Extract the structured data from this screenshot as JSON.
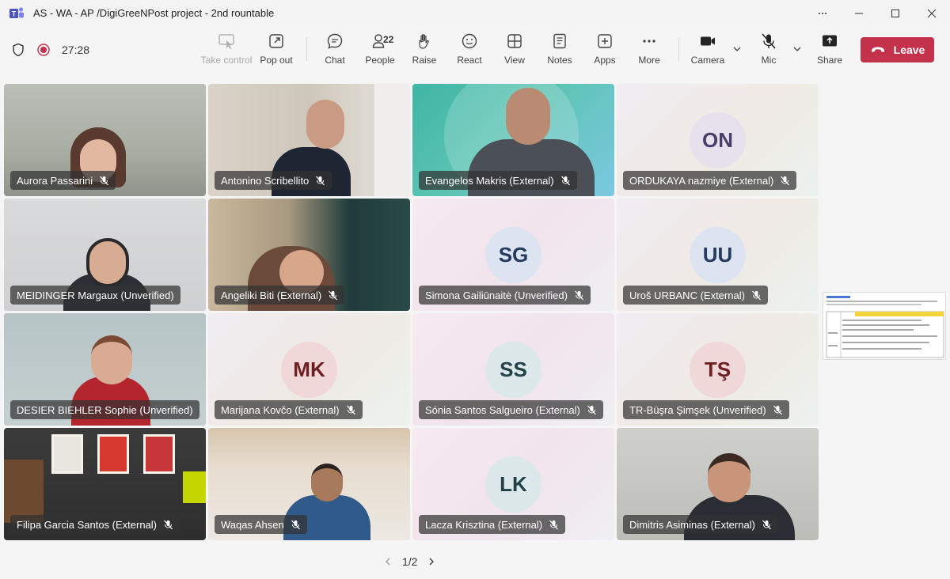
{
  "window": {
    "title": "AS - WA - AP /DigiGreeNPost project - 2nd rountable"
  },
  "toolbar": {
    "timer": "27:28",
    "take_control": "Take control",
    "pop_out": "Pop out",
    "chat": "Chat",
    "people": "People",
    "people_count": "22",
    "raise": "Raise",
    "react": "React",
    "view": "View",
    "notes": "Notes",
    "apps": "Apps",
    "more": "More",
    "camera": "Camera",
    "mic": "Mic",
    "share": "Share",
    "leave": "Leave",
    "leave_color": "#c4314b"
  },
  "participants": [
    {
      "name": "Aurora Passarini",
      "video": true
    },
    {
      "name": "Antonino Scribellito",
      "video": true
    },
    {
      "name": "Evangelos Makris (External)",
      "video": true
    },
    {
      "name": "ORDUKAYA nazmiye (External)",
      "initials": "ON",
      "avatar_bg": "#e7e1ee",
      "avatar_fg": "#4a3d6b"
    },
    {
      "name": "MEIDINGER Margaux (Unverified)",
      "video": true
    },
    {
      "name": "Angeliki Biti (External)",
      "video": true
    },
    {
      "name": "Simona Gailiūnaitė (Unverified)",
      "initials": "SG",
      "avatar_bg": "#dbe4f0",
      "avatar_fg": "#243a5e"
    },
    {
      "name": "Uroš URBANC (External)",
      "initials": "UU",
      "avatar_bg": "#dbe4f0",
      "avatar_fg": "#243a5e"
    },
    {
      "name": "DESIER BIEHLER Sophie (Unverified)",
      "video": true
    },
    {
      "name": "Marijana Kovčo (External)",
      "initials": "MK",
      "avatar_bg": "#f0d8d8",
      "avatar_fg": "#6e1f22"
    },
    {
      "name": "Sónia Santos Salgueiro (External)",
      "initials": "SS",
      "avatar_bg": "#dce8ea",
      "avatar_fg": "#214048"
    },
    {
      "name": "TR-Büşra Şimşek (Unverified)",
      "initials": "TŞ",
      "avatar_bg": "#f0d8d8",
      "avatar_fg": "#6e1f22"
    },
    {
      "name": "Filipa Garcia Santos (External)",
      "video": true
    },
    {
      "name": "Waqas Ahsen",
      "video": true
    },
    {
      "name": "Lacza Krisztina (External)",
      "initials": "LK",
      "avatar_bg": "#dce8ea",
      "avatar_fg": "#214048"
    },
    {
      "name": "Dimitris Asiminas (External)",
      "video": true
    }
  ],
  "pager": {
    "label": "1/2"
  }
}
